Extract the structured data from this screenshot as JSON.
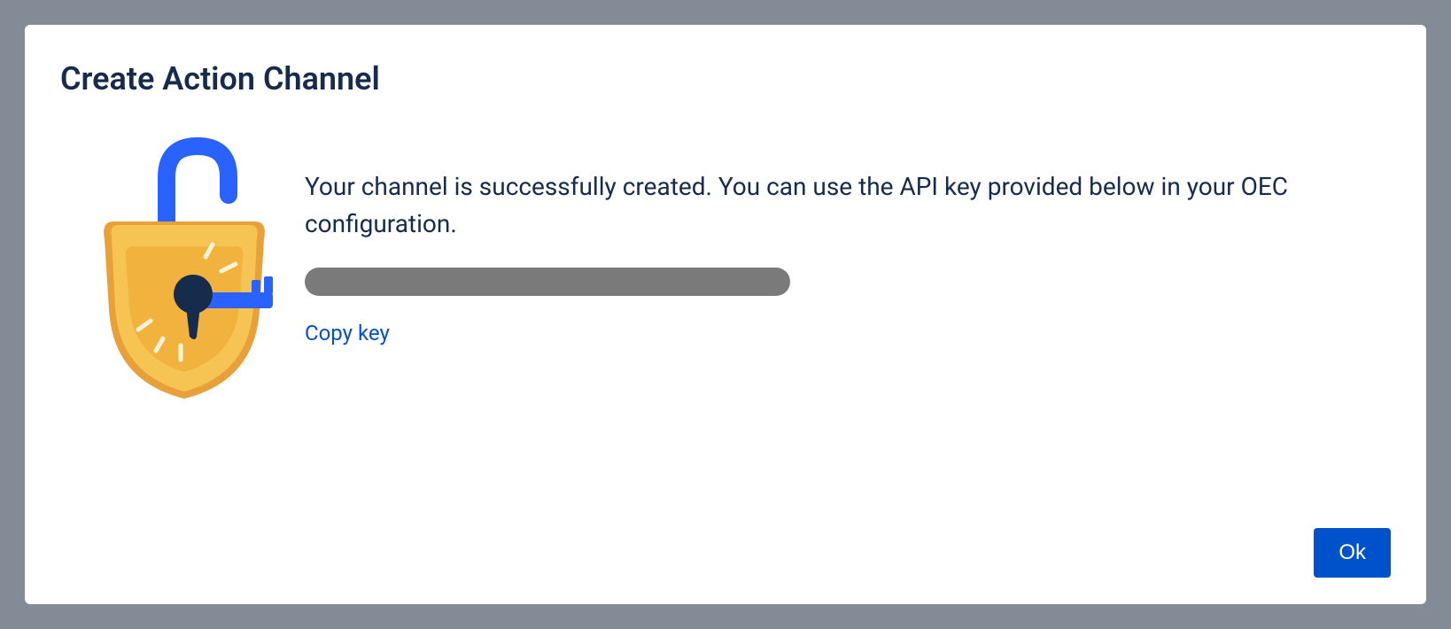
{
  "dialog": {
    "title": "Create Action Channel",
    "message": "Your channel is successfully created. You can use the API key provided below in your OEC configuration.",
    "copy_link_label": "Copy key",
    "ok_button_label": "Ok"
  }
}
